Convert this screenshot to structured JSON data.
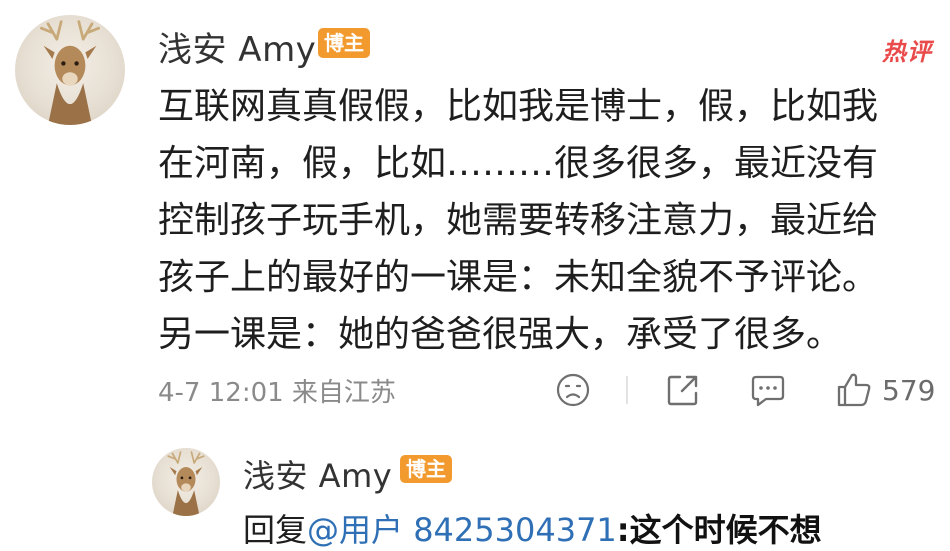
{
  "post": {
    "author": "浅安 Amy",
    "badge": "博主",
    "hot_label": "热评",
    "lines": [
      "互联网真真假假，比如我是博士，假，比如我",
      "在河南，假，比如………很多很多，最近没有",
      "控制孩子玩手机，她需要转移注意力，最近给",
      "孩子上的最好的一课是：未知全貌不予评论。",
      "另一课是：她的爸爸很强大，承受了很多。"
    ],
    "meta": "4-7 12:01 来自江苏",
    "like_count": "579"
  },
  "reply": {
    "author": "浅安 Amy",
    "badge": "博主",
    "prefix": "回复",
    "mention": "@用户 8425304371",
    "overlay_text": ":这个时候不想"
  },
  "icons": {
    "emoji": "frown-face-icon",
    "share": "share-icon",
    "comment": "comment-icon",
    "like": "thumbs-up-icon"
  },
  "colors": {
    "badge": "#f29a2e",
    "hot": "#e94a4a",
    "mention": "#2f6fb5",
    "meta": "#8a8a8a"
  }
}
